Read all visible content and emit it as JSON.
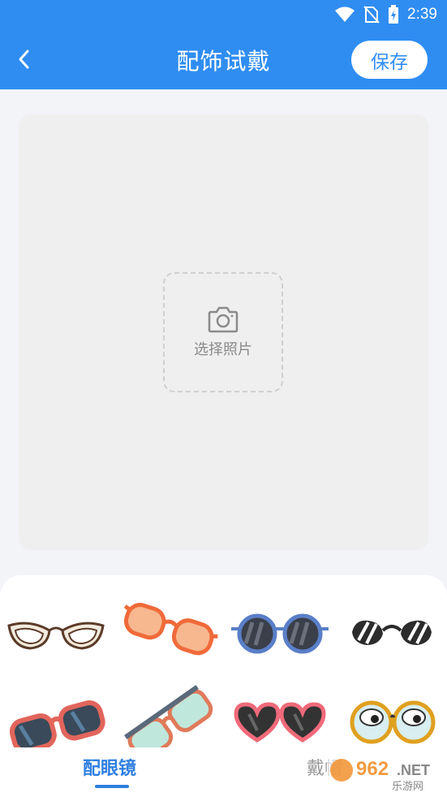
{
  "status_bar": {
    "time": "2:39",
    "icons": [
      "wifi-icon",
      "no-sim-icon",
      "battery-charging-icon"
    ]
  },
  "app_bar": {
    "title": "配饰试戴",
    "save_label": "保存",
    "back_icon": "back-chevron-icon"
  },
  "canvas": {
    "select_photo_label": "选择照片",
    "icon": "camera-icon"
  },
  "accessories": [
    {
      "name": "cat-eye-glasses",
      "icon": "glasses-icon"
    },
    {
      "name": "orange-sunglasses",
      "icon": "glasses-icon"
    },
    {
      "name": "round-blue-sunglasses",
      "icon": "glasses-icon"
    },
    {
      "name": "striped-sunglasses",
      "icon": "glasses-icon"
    },
    {
      "name": "red-sunglasses",
      "icon": "glasses-icon"
    },
    {
      "name": "teal-glasses",
      "icon": "glasses-icon"
    },
    {
      "name": "heart-sunglasses",
      "icon": "glasses-icon"
    },
    {
      "name": "googly-eye-glasses",
      "icon": "glasses-icon"
    }
  ],
  "tabs": [
    {
      "label": "配眼镜",
      "active": true
    },
    {
      "label": "戴帽",
      "active": false
    }
  ],
  "watermark": {
    "text": "962.NET",
    "sub": "乐游网"
  },
  "colors": {
    "primary": "#2f8df2",
    "tab_active": "#2f7fe0",
    "background": "#f3f4f8"
  }
}
